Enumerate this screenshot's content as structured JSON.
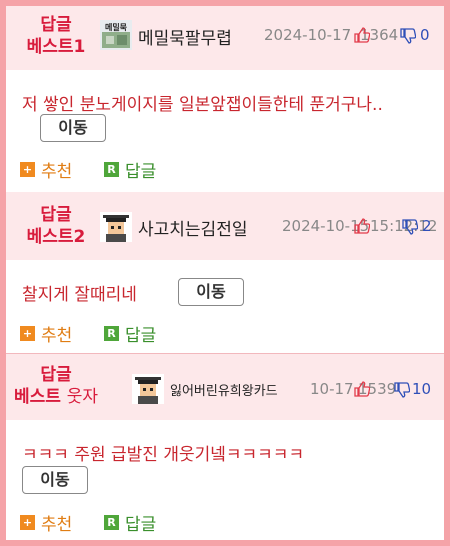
{
  "entries": [
    {
      "rank_line1": "답글",
      "rank_line2": "베스트1",
      "rank_suffix": "",
      "avatar": "logo-avatar",
      "avatar_text": "메밀묵",
      "nickname": "메밀묵팔무렵",
      "date": "2024-10-17",
      "views": "1364",
      "up": "",
      "down": "0",
      "content": "저 쌓인 분노게이지를 일본앞잽이들한테 푼거구나..",
      "move_label": "이동",
      "recommend_label": "추천",
      "reply_label": "답글"
    },
    {
      "rank_line1": "답글",
      "rank_line2": "베스트2",
      "rank_suffix": "",
      "avatar": "graduate-avatar",
      "avatar_text": "",
      "nickname": "사고치는김전일",
      "date": "2024-10-15",
      "views": "15:12:12",
      "up": "",
      "down": "2",
      "content": "찰지게 잘때리네",
      "move_label": "이동",
      "recommend_label": "추천",
      "reply_label": "답글"
    },
    {
      "rank_line1": "답글",
      "rank_line2": "베스트",
      "rank_suffix": "웃자",
      "avatar": "graduate-avatar",
      "avatar_text": "",
      "nickname": "잃어버린유희왕카드",
      "date": "10-17",
      "views": "1539",
      "up": "",
      "down": "10",
      "content": "ㅋㅋㅋ 주원 급발진 개웃기넼ㅋㅋㅋㅋㅋ",
      "move_label": "이동",
      "recommend_label": "추천",
      "reply_label": "답글"
    }
  ],
  "colors": {
    "frame": "#f5a3a8",
    "header_bg": "#fde8ea",
    "rank": "#d81b3c",
    "content": "#c8262e",
    "recommend": "#e07d14",
    "reply": "#3a8f2c",
    "thumb_up": "#e23b4b",
    "thumb_down": "#2f4fb8"
  }
}
